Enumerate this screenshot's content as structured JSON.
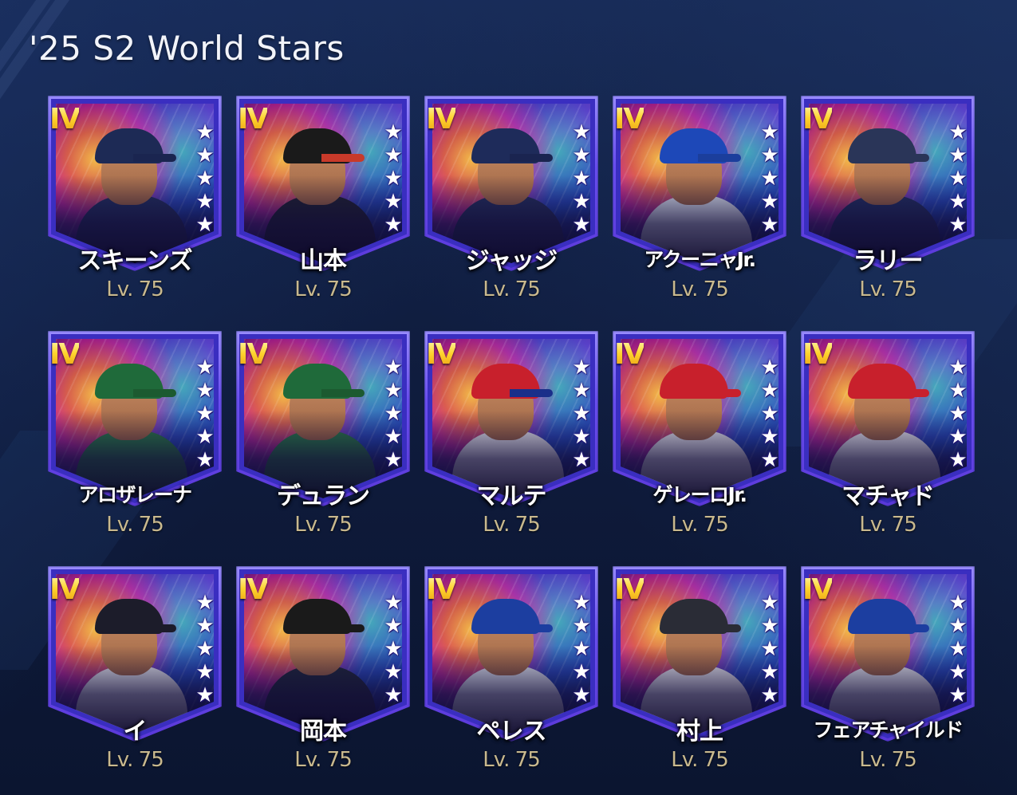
{
  "page": {
    "title": "'25 S2 World Stars"
  },
  "cards": [
    {
      "rank": "IV",
      "name": "スキーンズ",
      "level": "Lv. 75",
      "cap": "#1d2a55",
      "shirt": "#22305e",
      "brim": "#1a2550"
    },
    {
      "rank": "IV",
      "name": "山本",
      "level": "Lv. 75",
      "cap": "#1a1a1a",
      "shirt": "#1f2230",
      "brim": "#c83a2a"
    },
    {
      "rank": "IV",
      "name": "ジャッジ",
      "level": "Lv. 75",
      "cap": "#1e2b5a",
      "shirt": "#24305c",
      "brim": "#1a2450"
    },
    {
      "rank": "IV",
      "name": "アクーニャJr.",
      "level": "Lv. 75",
      "cap": "#1d48b8",
      "shirt": "#dfe6f2",
      "brim": "#1b3e9c"
    },
    {
      "rank": "IV",
      "name": "ラリー",
      "level": "Lv. 75",
      "cap": "#2a3558",
      "shirt": "#223060",
      "brim": "#2a3558"
    },
    {
      "rank": "IV",
      "name": "アロザレーナ",
      "level": "Lv. 75",
      "cap": "#1f6a3a",
      "shirt": "#2a7a46",
      "brim": "#1c5a30"
    },
    {
      "rank": "IV",
      "name": "デュラン",
      "level": "Lv. 75",
      "cap": "#1f6a3a",
      "shirt": "#2a7a46",
      "brim": "#1c5a30"
    },
    {
      "rank": "IV",
      "name": "マルテ",
      "level": "Lv. 75",
      "cap": "#c8202c",
      "shirt": "#e8e8ee",
      "brim": "#1a2f8a"
    },
    {
      "rank": "IV",
      "name": "ゲレーロJr.",
      "level": "Lv. 75",
      "cap": "#c8202c",
      "shirt": "#e8e8ee",
      "brim": "#c8202c"
    },
    {
      "rank": "IV",
      "name": "マチャド",
      "level": "Lv. 75",
      "cap": "#c8202c",
      "shirt": "#e8e8ee",
      "brim": "#c8202c"
    },
    {
      "rank": "IV",
      "name": "イ",
      "level": "Lv. 75",
      "cap": "#1c1c2a",
      "shirt": "#e6e8ee",
      "brim": "#1c1c2a"
    },
    {
      "rank": "IV",
      "name": "岡本",
      "level": "Lv. 75",
      "cap": "#1a1a1a",
      "shirt": "#1f2838",
      "brim": "#1a1a1a"
    },
    {
      "rank": "IV",
      "name": "ペレス",
      "level": "Lv. 75",
      "cap": "#1c3ea0",
      "shirt": "#dfe4ee",
      "brim": "#1c3ea0"
    },
    {
      "rank": "IV",
      "name": "村上",
      "level": "Lv. 75",
      "cap": "#2a2c36",
      "shirt": "#e8e8ee",
      "brim": "#2a2c36"
    },
    {
      "rank": "IV",
      "name": "フェアチャイルド",
      "level": "Lv. 75",
      "cap": "#1c3ea0",
      "shirt": "#e6e8ee",
      "brim": "#1c3ea0"
    }
  ]
}
